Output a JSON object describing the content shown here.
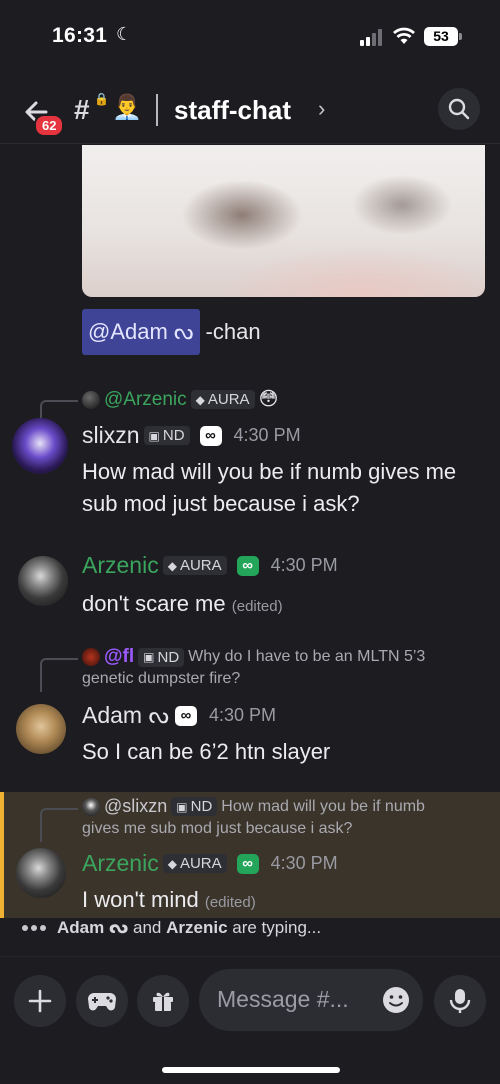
{
  "status_bar": {
    "time": "16:31",
    "battery": "53"
  },
  "header": {
    "badge_count": "62",
    "channel_name": "staff-chat",
    "channel_emoji": "👨‍💼"
  },
  "mention_message": {
    "mention": "@Adam ᔓ",
    "rest": "-chan"
  },
  "messages": [
    {
      "reply": {
        "user": "@Arzenic",
        "tag": "AURA",
        "text": "😳"
      },
      "username": "slixzn",
      "tag": "ND",
      "time": "4:30 PM",
      "body": "How mad will you be if numb gives me sub mod just because i ask?"
    },
    {
      "username": "Arzenic",
      "tag": "AURA",
      "time": "4:30 PM",
      "body": "don't scare me",
      "edited": "(edited)"
    },
    {
      "reply": {
        "user": "@fl",
        "tag": "ND",
        "text": "Why do I have to be an MLTN 5’3",
        "text2": "genetic dumpster fire?"
      },
      "username": "Adam ᔓ",
      "time": "4:30 PM",
      "body": "So I can be 6’2 htn slayer"
    },
    {
      "reply": {
        "user": "@slixzn",
        "tag": "ND",
        "text": "How mad will you be if numb",
        "text2": "gives me sub mod just because i ask?"
      },
      "username": "Arzenic",
      "tag": "AURA",
      "time": "4:30 PM",
      "body": "I won't mind",
      "edited": "(edited)"
    }
  ],
  "typing": {
    "user1": "Adam ᔓ",
    "and": "and",
    "user2": "Arzenic",
    "rest": "are typing..."
  },
  "composer": {
    "placeholder": "Message #..."
  },
  "colors": {
    "arzenic": "#3ba55d",
    "slixzn": "#e6e6ea",
    "fl": "#9b59ff",
    "mention_bg": "#3f4496",
    "highlight": "#f0b232"
  }
}
